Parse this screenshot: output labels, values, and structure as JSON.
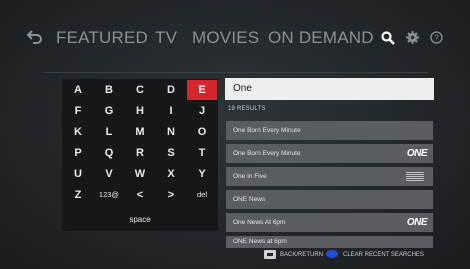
{
  "nav": {
    "items": [
      "FEATURED",
      "TV",
      "MOVIES",
      "ON DEMAND"
    ]
  },
  "icons": {
    "back": "back-arrow-icon",
    "search": "search-icon",
    "settings": "gear-icon",
    "help": "help-icon"
  },
  "keyboard": {
    "rows": [
      [
        "A",
        "B",
        "C",
        "D",
        "E"
      ],
      [
        "F",
        "G",
        "H",
        "I",
        "J"
      ],
      [
        "K",
        "L",
        "M",
        "N",
        "O"
      ],
      [
        "P",
        "Q",
        "R",
        "S",
        "T"
      ],
      [
        "U",
        "V",
        "W",
        "X",
        "Y"
      ],
      [
        "Z",
        "123@",
        "<",
        ">",
        "del"
      ]
    ],
    "active_key": "E",
    "space_label": "space"
  },
  "search": {
    "value": "One",
    "results_count": "19 RESULTS"
  },
  "results": [
    {
      "title": "One Born Every Minute",
      "logo": ""
    },
    {
      "title": "One Born Every Minute",
      "logo": "ONE"
    },
    {
      "title": "One In Five",
      "logo": "stamp"
    },
    {
      "title": "ONE News",
      "logo": ""
    },
    {
      "title": "One News At 6pm",
      "logo": "ONE"
    },
    {
      "title": "ONE News at 6pm",
      "logo": ""
    }
  ],
  "footer": {
    "back_label": "BACK/RETURN",
    "clear_label": "CLEAR RECENT SEARCHES"
  },
  "colors": {
    "active_key": "#d3262f",
    "blue_button": "#1d4fd8",
    "result_row": "#5a5e62"
  }
}
